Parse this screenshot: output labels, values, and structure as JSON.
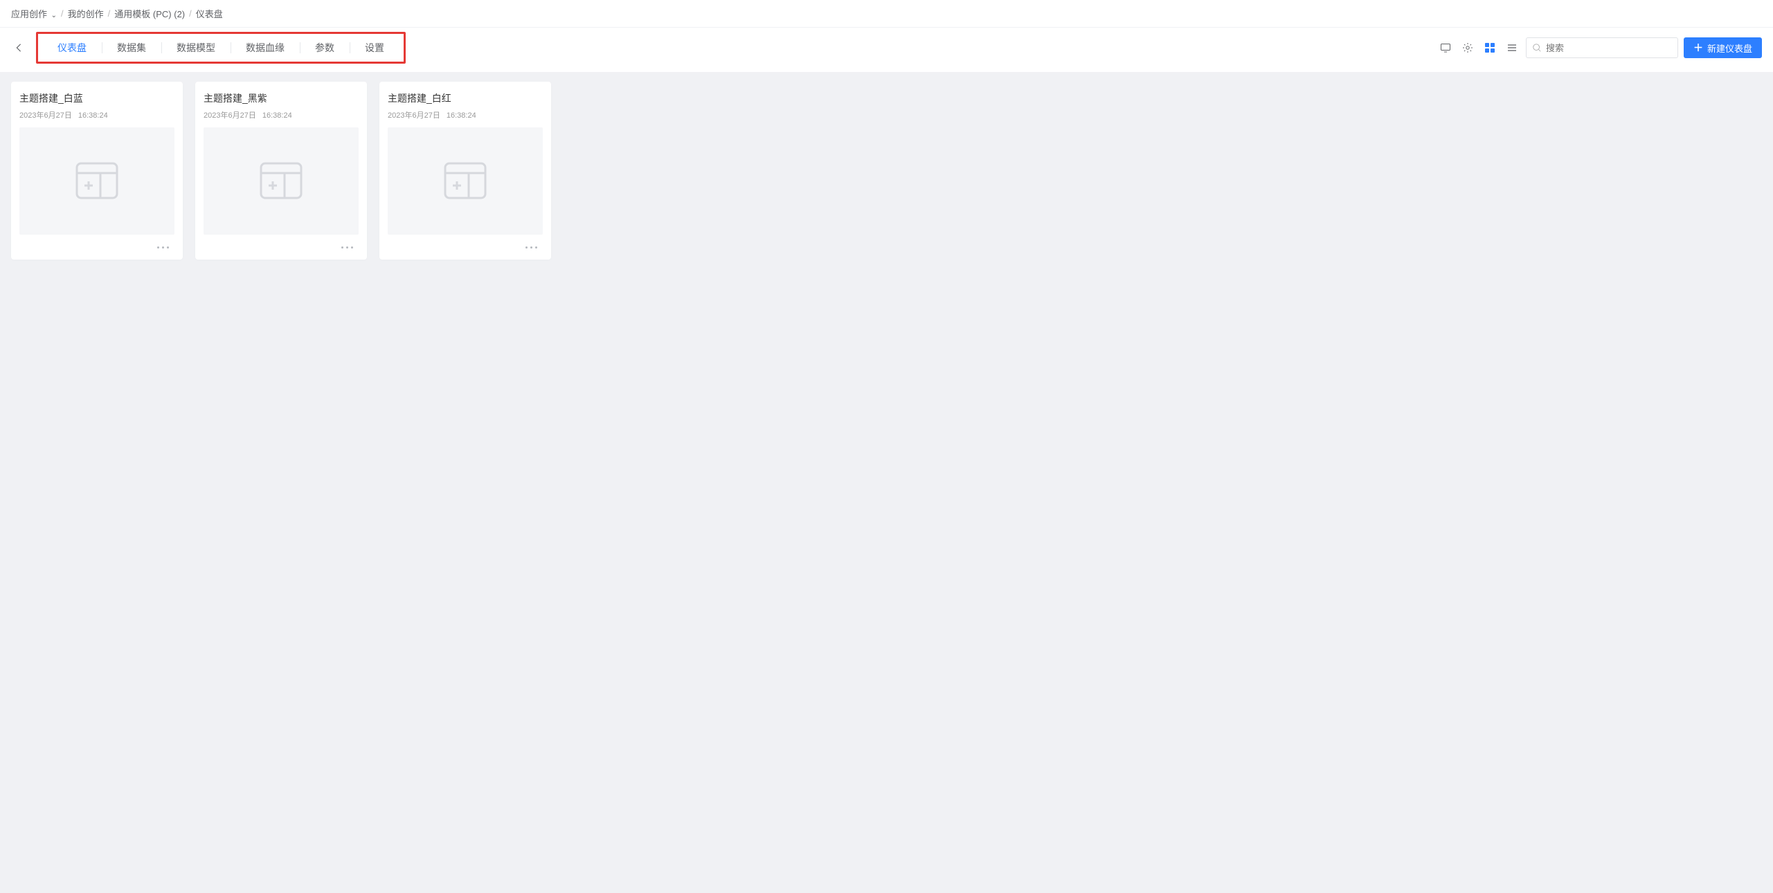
{
  "breadcrumb": {
    "items": [
      {
        "label": "应用创作",
        "has_dropdown": true
      },
      {
        "label": "我的创作",
        "has_dropdown": false
      },
      {
        "label": "通用模板 (PC) (2)",
        "has_dropdown": false
      },
      {
        "label": "仪表盘",
        "has_dropdown": false
      }
    ]
  },
  "tabs": [
    {
      "label": "仪表盘",
      "active": true
    },
    {
      "label": "数据集",
      "active": false
    },
    {
      "label": "数据模型",
      "active": false
    },
    {
      "label": "数据血缘",
      "active": false
    },
    {
      "label": "参数",
      "active": false
    },
    {
      "label": "设置",
      "active": false
    }
  ],
  "search": {
    "placeholder": "搜索"
  },
  "primary_button": {
    "label": "新建仪表盘"
  },
  "toolbar_icons": {
    "monitor": "monitor-icon",
    "gear": "gear-icon",
    "grid_view": "grid-view-icon",
    "list_view": "list-view-icon"
  },
  "cards": [
    {
      "title": "主题搭建_白蓝",
      "date": "2023年6月27日",
      "time": "16:38:24"
    },
    {
      "title": "主题搭建_黑紫",
      "date": "2023年6月27日",
      "time": "16:38:24"
    },
    {
      "title": "主题搭建_白红",
      "date": "2023年6月27日",
      "time": "16:38:24"
    }
  ]
}
